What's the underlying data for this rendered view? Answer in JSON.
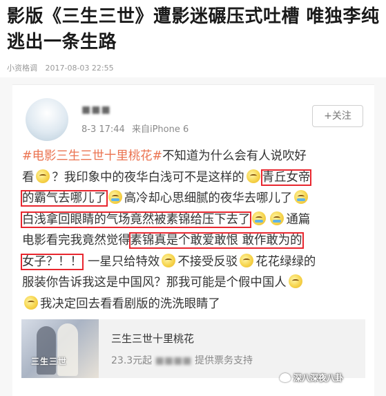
{
  "article": {
    "title": "影版《三生三世》遭影迷碾压式吐槽 唯独李纯逃出一条生路",
    "source": "小资格调",
    "date": "2017-08-03 22:55"
  },
  "post": {
    "username": "■■■",
    "time": "8-3 17:44",
    "device": "来自iPhone 6",
    "follow_label": "+关注",
    "lines": [
      [
        "#电影三生三世十里桃花#",
        "不知道为什么会有人说吹好"
      ],
      [
        "看",
        "？我印象中的夜华白浅可不是这样的",
        "青丘女帝"
      ],
      [
        "的霸气去哪儿了",
        "高冷却心思细腻的夜华去哪儿了"
      ],
      [
        "白浅拿回眼睛的气场竟然被素锦给压下去了",
        "通篇"
      ],
      [
        "电影看完我竟然觉得",
        "素锦真是个敢爱敢恨 敢作敢为的"
      ],
      [
        "女子？！！",
        "一星只给特效",
        "不接受反驳",
        "花花绿绿的"
      ],
      [
        "服装你告诉我这是中国风？那我可能是个假中国人"
      ],
      [
        "我决定回去看看剧版的洗洗眼睛了"
      ]
    ]
  },
  "film_card": {
    "title": "三生三世十里桃花",
    "price": "23.3元起",
    "provider_blurred": "■■■■",
    "provider_suffix": "提供票务支持",
    "poster_text": "三生三世"
  },
  "watermark": {
    "text": "深八深夜八卦"
  },
  "colors": {
    "tag": "#eb7350",
    "highlight_box": "#e8262e",
    "card_background": "#f7f7f7"
  },
  "icons": [
    "avatar",
    "emoji-smile",
    "emoji-laugh",
    "wechat-icon"
  ]
}
